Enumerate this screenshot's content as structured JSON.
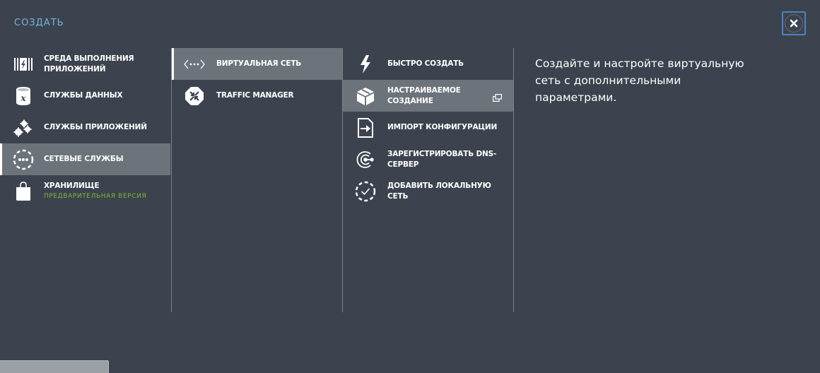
{
  "header": {
    "title": "СОЗДАТЬ",
    "close_icon": "close-icon"
  },
  "categories": [
    {
      "label": "СРЕДА ВЫПОЛНЕНИЯ ПРИЛОЖЕНИЙ",
      "icon": "compute-icon",
      "selected": false
    },
    {
      "label": "СЛУЖБЫ ДАННЫХ",
      "icon": "data-services-icon",
      "selected": false
    },
    {
      "label": "СЛУЖБЫ ПРИЛОЖЕНИЙ",
      "icon": "app-services-icon",
      "selected": false
    },
    {
      "label": "СЕТЕВЫЕ СЛУЖБЫ",
      "icon": "network-services-icon",
      "selected": true
    },
    {
      "label": "ХРАНИЛИЩЕ",
      "sublabel": "ПРЕДВАРИТЕЛЬНАЯ ВЕРСИЯ",
      "icon": "store-icon",
      "selected": false
    }
  ],
  "services": [
    {
      "label": "ВИРТУАЛЬНАЯ СЕТЬ",
      "icon": "virtual-network-icon",
      "selected": true
    },
    {
      "label": "TRAFFIC MANAGER",
      "icon": "traffic-manager-icon",
      "selected": false
    }
  ],
  "actions": [
    {
      "label": "БЫСТРО СОЗДАТЬ",
      "icon": "lightning-icon",
      "selected": false
    },
    {
      "label": "НАСТРАИВАЕМОЕ СОЗДАНИЕ",
      "icon": "box-icon",
      "selected": true,
      "trailing_icon": "popout-window-icon"
    },
    {
      "label": "ИМПОРТ КОНФИГУРАЦИИ",
      "icon": "import-file-icon",
      "selected": false
    },
    {
      "label": "ЗАРЕГИСТРИРОВАТЬ DNS-СЕРВЕР",
      "icon": "dns-server-icon",
      "selected": false
    },
    {
      "label": "ДОБАВИТЬ ЛОКАЛЬНУЮ СЕТЬ",
      "icon": "local-network-check-icon",
      "selected": false
    }
  ],
  "description": "Создайте и настройте виртуальную сеть с дополнительными параметрами.",
  "colors": {
    "background": "#3d434e",
    "selected": "#6d737b",
    "title_accent": "#6fb4de",
    "preview_green": "#7db83a",
    "close_border": "#4a84c0"
  }
}
